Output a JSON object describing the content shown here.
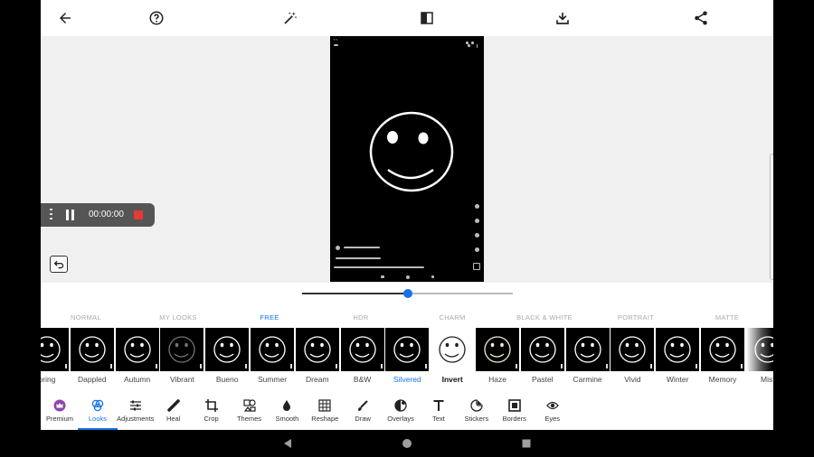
{
  "toolbar": {
    "buttons": [
      "back",
      "help",
      "auto-fix",
      "compare",
      "download",
      "share"
    ]
  },
  "recorder": {
    "time": "00:00:00"
  },
  "slider": {
    "value": 0.5
  },
  "categories": [
    {
      "label": "NORMAL",
      "active": false
    },
    {
      "label": "MY LOOKS",
      "active": false
    },
    {
      "label": "FREE",
      "active": true
    },
    {
      "label": "HDR",
      "active": false
    },
    {
      "label": "CHARM",
      "active": false
    },
    {
      "label": "BLACK & WHITE",
      "active": false
    },
    {
      "label": "PORTRAIT",
      "active": false
    },
    {
      "label": "MATTE",
      "active": false
    }
  ],
  "looks": [
    {
      "label": "pring",
      "style": "dark"
    },
    {
      "label": "Dappled",
      "style": "dark"
    },
    {
      "label": "Autumn",
      "style": "dark"
    },
    {
      "label": "Vibrant",
      "style": "dim"
    },
    {
      "label": "Bueno",
      "style": "dark"
    },
    {
      "label": "Summer",
      "style": "dark"
    },
    {
      "label": "Dream",
      "style": "dark"
    },
    {
      "label": "B&W",
      "style": "dark"
    },
    {
      "label": "Silvered",
      "style": "dark",
      "selected": true
    },
    {
      "label": "Invert",
      "style": "invert",
      "bold": true
    },
    {
      "label": "Haze",
      "style": "warm"
    },
    {
      "label": "Pastel",
      "style": "dark"
    },
    {
      "label": "Carmine",
      "style": "dark"
    },
    {
      "label": "Vivid",
      "style": "dark"
    },
    {
      "label": "Winter",
      "style": "dark"
    },
    {
      "label": "Memory",
      "style": "dark"
    },
    {
      "label": "Mist",
      "style": "mist"
    }
  ],
  "nav": [
    {
      "label": "Premium",
      "icon": "crown-icon"
    },
    {
      "label": "Looks",
      "icon": "looks-icon",
      "active": true
    },
    {
      "label": "Adjustments",
      "icon": "sliders-icon"
    },
    {
      "label": "Heal",
      "icon": "bandage-icon"
    },
    {
      "label": "Crop",
      "icon": "crop-icon"
    },
    {
      "label": "Themes",
      "icon": "themes-icon"
    },
    {
      "label": "Smooth",
      "icon": "drop-icon"
    },
    {
      "label": "Reshape",
      "icon": "grid-icon"
    },
    {
      "label": "Draw",
      "icon": "brush-icon"
    },
    {
      "label": "Overlays",
      "icon": "overlays-icon"
    },
    {
      "label": "Text",
      "icon": "text-icon"
    },
    {
      "label": "Stickers",
      "icon": "sticker-icon"
    },
    {
      "label": "Borders",
      "icon": "border-icon"
    },
    {
      "label": "Eyes",
      "icon": "eye-icon"
    }
  ],
  "colors": {
    "accent": "#1473e6",
    "stop": "#e53935",
    "premium": "#8e44ad"
  }
}
